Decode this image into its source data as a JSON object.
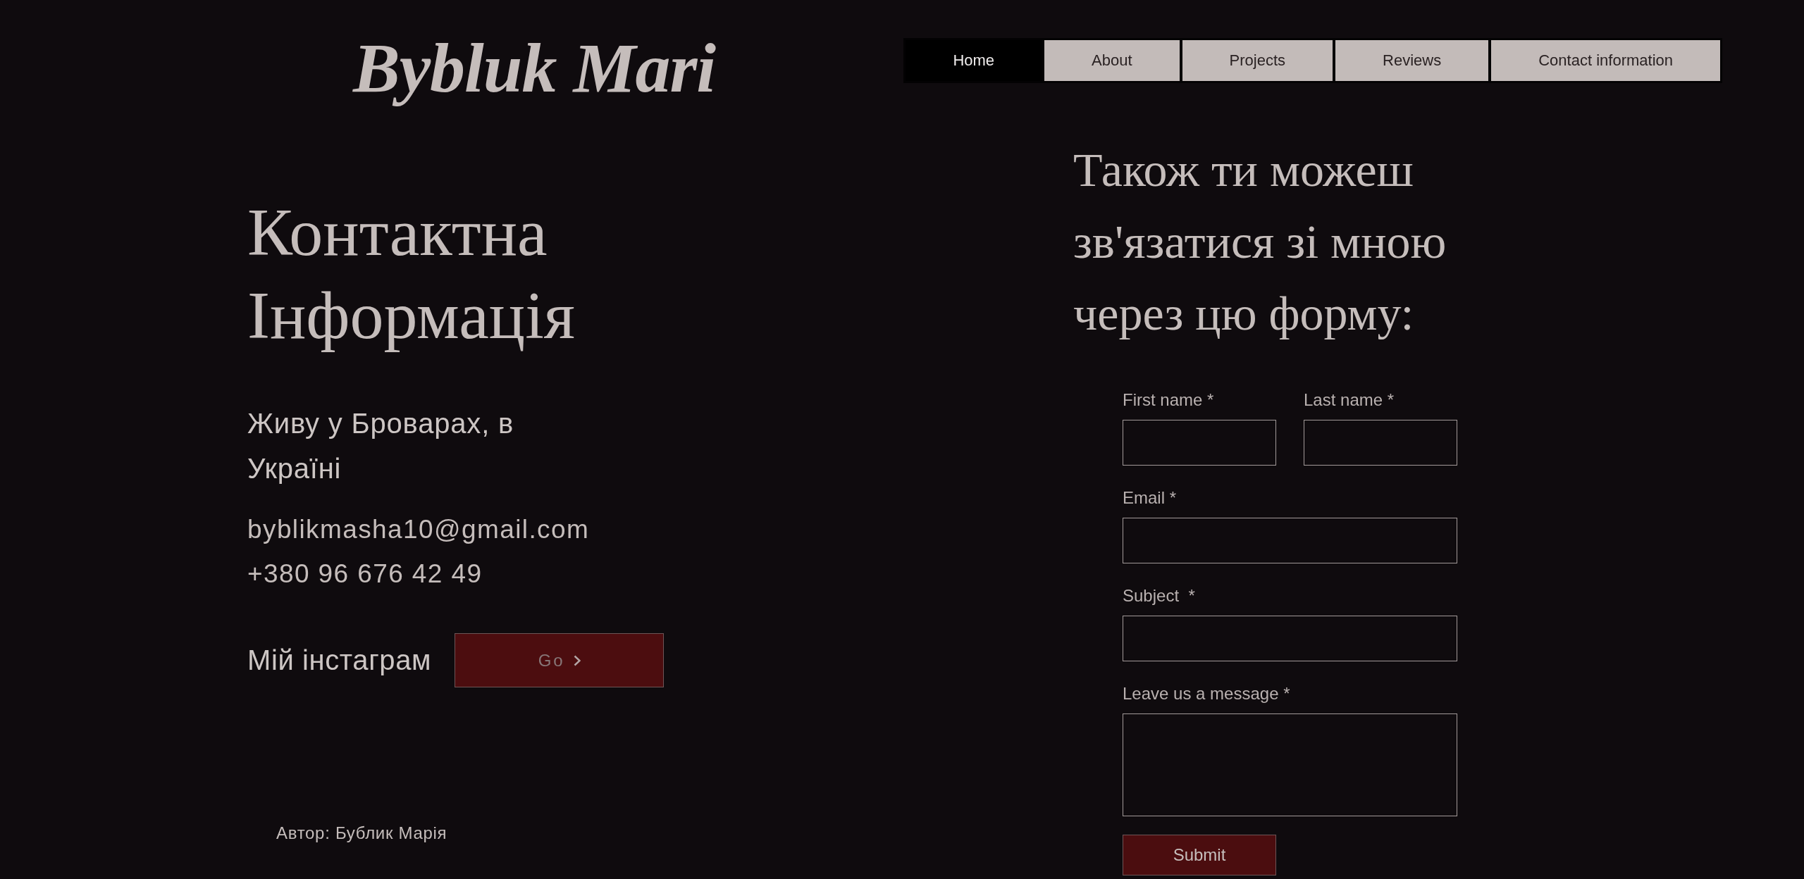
{
  "header": {
    "logo": "Bybluk Mari"
  },
  "nav": {
    "items": [
      {
        "label": "Home",
        "selected": true
      },
      {
        "label": "About",
        "selected": false
      },
      {
        "label": "Projects",
        "selected": false
      },
      {
        "label": "Reviews",
        "selected": false
      },
      {
        "label": "Contact information",
        "selected": false
      }
    ]
  },
  "contact": {
    "title": "Контактна Інформація",
    "address": "Живу у Броварах, в Україні",
    "email": "byblikmasha10@gmail.com",
    "phone": "+380 96 676 42 49",
    "instagram": {
      "label": "Мій інстаграм",
      "button": "Go"
    },
    "author": "Автор: Бублик Марія"
  },
  "form": {
    "title": "Також ти можеш зв'язатися зі мною через цю форму:",
    "rows": [
      {
        "fields": [
          {
            "label": "First name *",
            "kind": "text"
          },
          {
            "label": "Last name *",
            "kind": "text"
          }
        ]
      },
      {
        "fields": [
          {
            "label": "Email *",
            "kind": "text"
          }
        ]
      },
      {
        "fields": [
          {
            "label": "Subject  *",
            "kind": "text"
          }
        ]
      },
      {
        "fields": [
          {
            "label": "Leave us a message *",
            "kind": "textarea"
          }
        ]
      }
    ],
    "submit": "Submit"
  }
}
